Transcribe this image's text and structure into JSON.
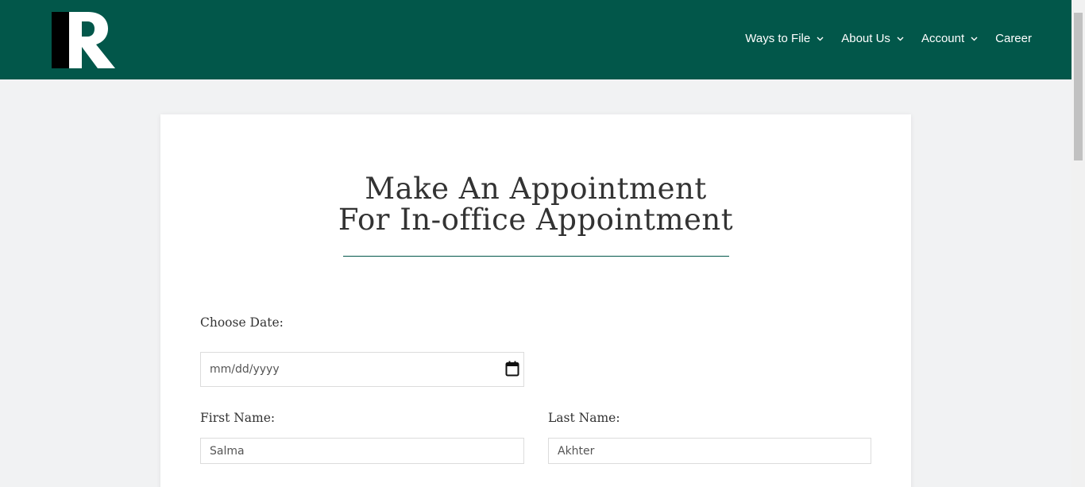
{
  "header": {
    "logo_alt": "PR",
    "nav": [
      {
        "label": "Ways to File",
        "has_dropdown": true
      },
      {
        "label": "About Us",
        "has_dropdown": true
      },
      {
        "label": "Account",
        "has_dropdown": true
      },
      {
        "label": "Career",
        "has_dropdown": false
      }
    ]
  },
  "form": {
    "title_line1": "Make An Appointment",
    "title_line2": "For In-office Appointment",
    "date_label": "Choose Date:",
    "date_placeholder": "mm/dd/yyyy",
    "first_name_label": "First Name:",
    "first_name_value": "Salma",
    "last_name_label": "Last Name:",
    "last_name_value": "Akhter"
  },
  "colors": {
    "brand": "#02574a",
    "background": "#f1f2f3"
  }
}
